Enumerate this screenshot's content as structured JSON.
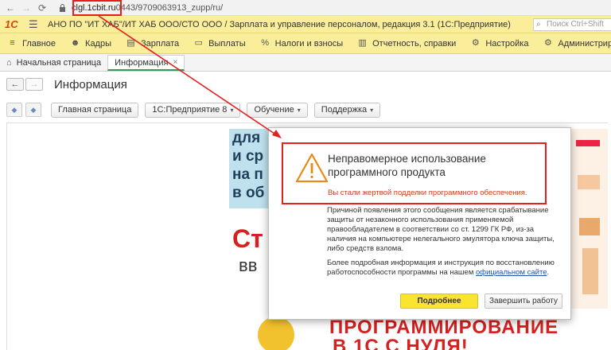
{
  "browser": {
    "back": "←",
    "forward": "→",
    "reload": "⟳",
    "url_host": "clgl.1cbit.ru",
    "url_rest": "0443/9709063913_zupp/ru/"
  },
  "app": {
    "logo": "1С",
    "title": "АНО ПО \"ИТ ХАБ\"/ИТ ХАБ ООО/СТО ООО / Зарплата и управление персоналом, редакция 3.1  (1С:Предприятие)",
    "search_placeholder": "Поиск Ctrl+Shift"
  },
  "sections": [
    {
      "label": "Главное",
      "icon": "≡"
    },
    {
      "label": "Кадры",
      "icon": "☻"
    },
    {
      "label": "Зарплата",
      "icon": "▤"
    },
    {
      "label": "Выплаты",
      "icon": "▭"
    },
    {
      "label": "Налоги и взносы",
      "icon": "%"
    },
    {
      "label": "Отчетность, справки",
      "icon": "▥"
    },
    {
      "label": "Настройка",
      "icon": "⚙"
    },
    {
      "label": "Администрирование",
      "icon": "⚙"
    }
  ],
  "tabs": [
    {
      "label": "Начальная страница"
    },
    {
      "label": "Информация",
      "close": "×"
    }
  ],
  "form": {
    "title": "Информация",
    "back": "←",
    "forward": "→"
  },
  "toolbar": {
    "main_page": "Главная страница",
    "enterprise": "1С:Предприятие 8",
    "training": "Обучение",
    "support": "Поддержка",
    "dropdown": "▾"
  },
  "banners": {
    "b1_lines": [
      "для",
      "и ср",
      "на п",
      "в об"
    ],
    "b2_red": "Ст",
    "b2_text": "вв",
    "b3_line1": "ПРОГРАММИРОВАНИЕ",
    "b3_line2": "В 1С С НУЛЯ!"
  },
  "modal": {
    "title": "Неправомерное использование программного продукта",
    "subtitle": "Вы стали жертвой подделки программного обеспечения.",
    "paragraph1": "Причиной появления этого сообщения является срабатывание защиты от незаконного использования применяемой правообладателем в соответствии со ст. 1299 ГК РФ, из-за наличия на компьютере нелегального эмулятора ключа защиты, либо средств взлома.",
    "paragraph2_text": "Более подробная информация и инструкция по восстановлению работоспособности программы на нашем ",
    "paragraph2_link": "официальном сайте",
    "paragraph2_end": ".",
    "button_primary": "Подробнее",
    "button_secondary": "Завершить работу"
  },
  "colors": {
    "accent_yellow": "#fbee9b",
    "annotation_red": "#e41f1f",
    "warning_text": "#d43a1a",
    "primary_button": "#f9e52f",
    "active_tab_underline": "#3a9a5a"
  }
}
